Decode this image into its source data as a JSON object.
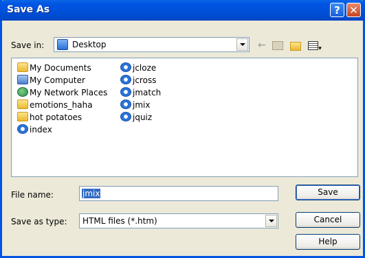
{
  "window": {
    "title": "Save As"
  },
  "titlebar": {
    "help_glyph": "?",
    "close_glyph": "✕"
  },
  "save_in": {
    "label": "Save in:",
    "value": "Desktop"
  },
  "toolbar": {
    "back_icon": "arrow-left-icon",
    "up_icon": "folder-up-icon",
    "new_folder_icon": "new-folder-icon",
    "views_icon": "views-menu-icon"
  },
  "files": [
    {
      "name": "My Documents",
      "icon": "my-documents-icon"
    },
    {
      "name": "My Computer",
      "icon": "my-computer-icon"
    },
    {
      "name": "My Network Places",
      "icon": "network-places-icon"
    },
    {
      "name": "emotions_haha",
      "icon": "folder-icon"
    },
    {
      "name": "hot potatoes",
      "icon": "folder-icon"
    },
    {
      "name": "index",
      "icon": "ie-document-icon"
    },
    {
      "name": "jcloze",
      "icon": "ie-document-icon"
    },
    {
      "name": "jcross",
      "icon": "ie-document-icon"
    },
    {
      "name": "jmatch",
      "icon": "ie-document-icon"
    },
    {
      "name": "jmix",
      "icon": "ie-document-icon"
    },
    {
      "name": "jquiz",
      "icon": "ie-document-icon"
    }
  ],
  "file_name": {
    "label": "File name:",
    "value": "jmix"
  },
  "save_as_type": {
    "label": "Save as type:",
    "value": "HTML files (*.htm)"
  },
  "buttons": {
    "save": "Save",
    "cancel": "Cancel",
    "help": "Help"
  },
  "colors": {
    "titlebar": "#0054E3",
    "dialog_bg": "#ECE9D8",
    "selection": "#316AC5"
  }
}
